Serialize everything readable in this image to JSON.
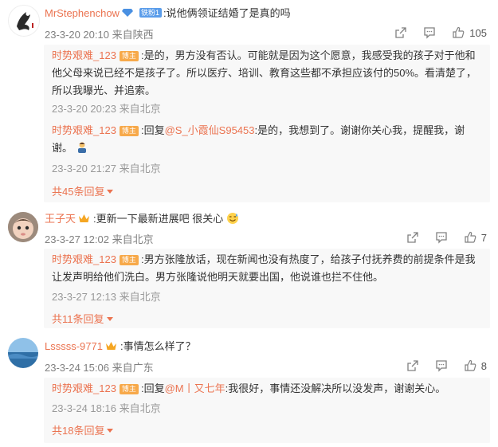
{
  "comments": [
    {
      "user": "MrStephenchow",
      "badge": "铁粉1",
      "text": "说他俩领证结婚了是真的吗",
      "time": "23-3-20 20:10",
      "location": "来自陕西",
      "likes": "105",
      "replies": [
        {
          "user": "时势艰难_123",
          "badge": "博主",
          "text": "是的，男方没有否认。可能就是因为这个愿意，我感受我的孩子对于他和他父母来说已经不是孩子了。所以医疗、培训、教育这些都不承担应该付的50%。看清楚了，所以我曝光、并追索。",
          "time": "23-3-20 20:23",
          "location": "来自北京"
        },
        {
          "user": "时势艰难_123",
          "badge": "博主",
          "prefix": "回复",
          "mention": "@S_小霞仙S95453",
          "text": "是的，我想到了。谢谢你关心我，提醒我，谢谢。",
          "emoji": "person-bowing-emoji",
          "time": "23-3-20 21:27",
          "location": "来自北京"
        }
      ],
      "more": "共45条回复"
    },
    {
      "user": "王子天",
      "text": "更新一下最新进展吧 很关心",
      "emoji": "sweat-smile-emoji",
      "time": "23-3-27 12:02",
      "location": "来自北京",
      "likes": "7",
      "replies": [
        {
          "user": "时势艰难_123",
          "badge": "博主",
          "text": "男方张隆放话，现在新闻也没有热度了，给孩子付抚养费的前提条件是我让发声明给他们洗白。男方张隆说他明天就要出国，他说谁也拦不住他。",
          "time": "23-3-27 12:13",
          "location": "来自北京"
        }
      ],
      "more": "共11条回复"
    },
    {
      "user": "Lsssss-9771",
      "text": "事情怎么样了？",
      "time": "23-3-24 15:06",
      "location": "来自广东",
      "likes": "8",
      "replies": [
        {
          "user": "时势艰难_123",
          "badge": "博主",
          "prefix": "回复",
          "mention": "@M丨又七年",
          "text": "我很好，事情还没解决所以没发声，谢谢关心。",
          "time": "23-3-24 18:16",
          "location": "来自北京"
        }
      ],
      "more": "共18条回复"
    }
  ],
  "colors": {
    "name": "#eb7350",
    "meta": "#808080",
    "blogger_badge": "#f7a94a",
    "fan_badge": "#5b9dea"
  }
}
